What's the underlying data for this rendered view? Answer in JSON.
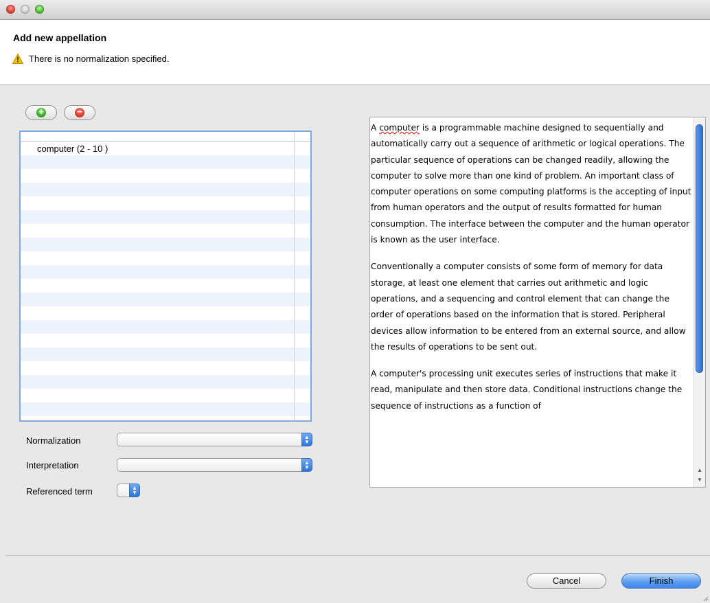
{
  "window": {
    "controls": [
      "close-button",
      "minimize-button",
      "zoom-button"
    ]
  },
  "header": {
    "title": "Add new appellation",
    "message": "There is no normalization specified.",
    "message_icon": "warning-icon"
  },
  "toolbar": {
    "add_icon": "plus-icon",
    "remove_icon": "minus-icon",
    "add_glyph": "+",
    "remove_glyph": "−"
  },
  "list": {
    "items": [
      "computer (2 - 10 )"
    ]
  },
  "form": {
    "normalization_label": "Normalization",
    "normalization_value": "",
    "interpretation_label": "Interpretation",
    "interpretation_value": "",
    "referenced_term_label": "Referenced term",
    "referenced_term_value": ""
  },
  "text_panel": {
    "first_word": "computer",
    "p1_before": "A ",
    "p1_after": " is a programmable machine designed to sequentially and automatically carry out a sequence of arithmetic or logical operations. The particular sequence of operations can be changed readily, allowing the computer to solve more than one kind of problem. An important class of computer operations on some computing platforms is the accepting of input from human operators and the output of results formatted for human consumption. The interface between the computer and the human operator is known as the user interface.",
    "p2": "Conventionally a computer consists of some form of memory for data storage, at least one element that carries out arithmetic and logic operations, and a sequencing and control element that can change the order of operations based on the information that is stored. Peripheral devices allow information to be entered from an external source, and allow the results of operations to be sent out.",
    "p3": "A computer's processing unit executes series of instructions that make it read, manipulate and then store data. Conditional instructions change the sequence of instructions as a function of"
  },
  "buttons": {
    "cancel": "Cancel",
    "finish": "Finish"
  },
  "colors": {
    "accent": "#3f86ea",
    "warning": "#f2c200",
    "add": "#2e9f1c",
    "remove": "#d62a1c"
  }
}
